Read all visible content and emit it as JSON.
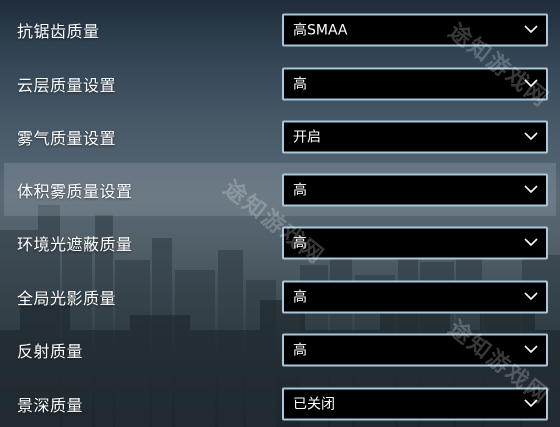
{
  "settings": [
    {
      "label": "抗锯齿质量",
      "value": "高SMAA"
    },
    {
      "label": "云层质量设置",
      "value": "高"
    },
    {
      "label": "雾气质量设置",
      "value": "开启"
    },
    {
      "label": "体积雾质量设置",
      "value": "高"
    },
    {
      "label": "环境光遮蔽质量",
      "value": "高"
    },
    {
      "label": "全局光影质量",
      "value": "高"
    },
    {
      "label": "反射质量",
      "value": "高"
    },
    {
      "label": "景深质量",
      "value": "已关闭"
    }
  ],
  "watermarks": [
    "途知游戏网",
    "途知游戏网",
    "途知游戏网"
  ],
  "colors": {
    "dropdown_border": "#a9c8dc",
    "dropdown_bg": "#000000",
    "label_text": "#ffffff",
    "highlight_row": "#9aa2aa"
  }
}
